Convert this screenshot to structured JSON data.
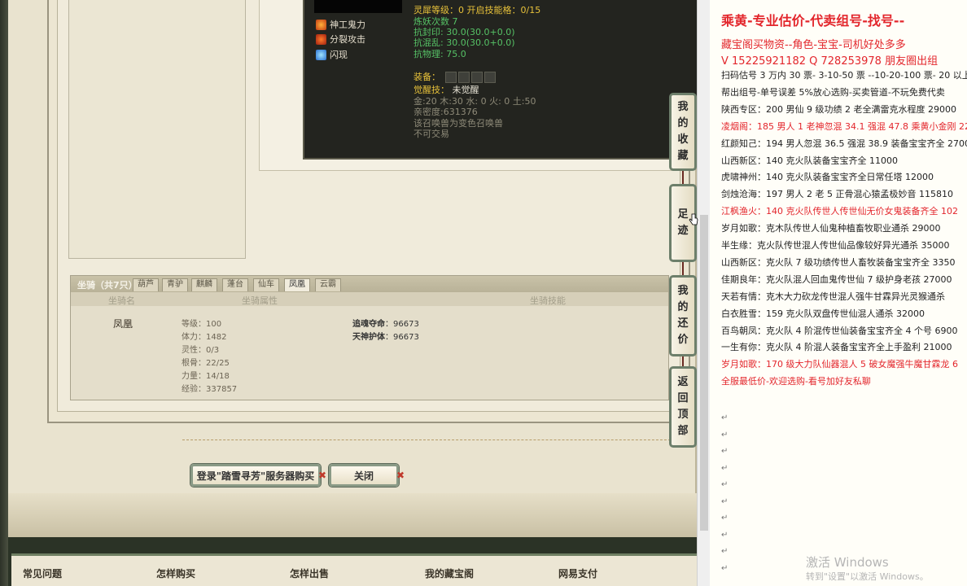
{
  "tooltip": {
    "skills": [
      "神工鬼力",
      "分裂攻击",
      "闪现"
    ],
    "lines": [
      {
        "text": "灵犀等级：0  开启技能格：0/15",
        "cls": "c-yellow"
      },
      {
        "text": "炼妖次数 7",
        "cls": "c-green"
      },
      {
        "text": "抗封印: 30.0(30.0+0.0)",
        "cls": "c-green"
      },
      {
        "text": "抗混乱: 30.0(30.0+0.0)",
        "cls": "c-green"
      },
      {
        "text": "抗物理: 75.0",
        "cls": "c-green"
      }
    ],
    "equip_label": "装备：",
    "awaken_label": "觉醒技：",
    "awaken_value": "未觉醒",
    "elements": "金:20 木:30 水: 0 火: 0 土:50",
    "intimacy": "亲密度:631376",
    "note1": "该召唤兽为变色召唤兽",
    "note2": "不可交易"
  },
  "mount": {
    "title": "坐骑（共7只）",
    "tabs": [
      "葫芦",
      "青驴",
      "麒麟",
      "蓬台",
      "仙车",
      "凤凰",
      "云霸"
    ],
    "active_tab": "凤凰",
    "header": {
      "name": "坐骑名",
      "attrs": "坐骑属性",
      "skills": "坐骑技能"
    },
    "name": "凤凰",
    "attributes": [
      "等级：100",
      "体力：1482",
      "灵性：0/3",
      "根骨：22/25",
      "力量：14/18",
      "经验：337857"
    ],
    "skill_list": [
      {
        "name": "追魂夺命",
        "value": "96673"
      },
      {
        "name": "天神护体",
        "value": "96673"
      }
    ]
  },
  "buttons": {
    "buy": "登录\"踏雪寻芳\"服务器购买",
    "close": "关闭"
  },
  "side": {
    "favorites": [
      "我",
      "的",
      "收",
      "藏"
    ],
    "footprint": [
      "足",
      "迹"
    ],
    "bargain": [
      "我",
      "的",
      "还",
      "价"
    ],
    "back_top": [
      "返",
      "回",
      "顶",
      "部"
    ]
  },
  "bottom_nav": [
    "常见问题",
    "怎样购买",
    "怎样出售",
    "我的藏宝阁",
    "网易支付"
  ],
  "doc": {
    "title": "乘黄-专业估价-代卖组号-找号--",
    "subtitle1": "藏宝阁买物资--角色-宝宝-司机好处多多",
    "subtitle2": "V 15225921182  Q 728253978 朋友圈出组",
    "lines": [
      {
        "text": "扫码估号 3 万内 30 票- 3-10-50 票  --10-20-100 票- 20 以上",
        "red": false
      },
      {
        "text": "帮出组号-单号误差 5%放心选购-买卖管道-不玩免费代卖",
        "red": false
      },
      {
        "text": "陕西专区：200 男仙 9 级功绩 2 老全满雷克水程度 29000",
        "red": false
      },
      {
        "text": "凌烟阁：185 男人 1 老神忽混 34.1 强混 47.8 乘黄小金刚 22",
        "red": true
      },
      {
        "text": "红颜知己：194 男人忽混 36.5 强混 38.9 装备宝宝齐全 2700",
        "red": false
      },
      {
        "text": "山西新区：140 克火队装备宝宝齐全 11000",
        "red": false
      },
      {
        "text": "虎啸神州：140 克火队装备宝宝齐全日常任塔 12000",
        "red": false
      },
      {
        "text": "剑烛沧海：197 男人 2 老 5 正骨混心猿孟极妙音 115810",
        "red": false
      },
      {
        "text": "江枫渔火：140 克火队传世人传世仙无价女鬼装备齐全 102",
        "red": true
      },
      {
        "text": "岁月如歌：克木队传世人仙鬼种植畜牧职业通杀 29000",
        "red": false
      },
      {
        "text": "半生缘：克火队传世混人传世仙品像较好异光通杀 35000",
        "red": false
      },
      {
        "text": "山西新区：克火队 7 级功绩传世人畜牧装备宝宝齐全 3350",
        "red": false
      },
      {
        "text": "佳期良年：克火队混人回血鬼传世仙 7 级护身老孩 27000",
        "red": false
      },
      {
        "text": "天若有情：克木大力砍龙传世混人强牛甘霖异光灵猴通杀",
        "red": false
      },
      {
        "text": "白衣胜雪：159 克火队双盘传世仙混人通杀 32000",
        "red": false
      },
      {
        "text": "百鸟朝凤：克火队 4 阶混传世仙装备宝宝齐全 4 个号 6900",
        "red": false
      },
      {
        "text": "一生有你：克火队 4 阶混人装备宝宝齐全上手盈利 21000",
        "red": false
      },
      {
        "text": "岁月如歌：170 级大力队仙器混人 5 破女魔强牛魔甘霖龙 6",
        "red": true
      },
      {
        "text": "全服最低价-欢迎选购-看号加好友私聊",
        "red": true
      }
    ],
    "para_mark": "↵",
    "watermark": "激活 Windows",
    "watermark_sub": "转到\"设置\"以激活 Windows。"
  }
}
